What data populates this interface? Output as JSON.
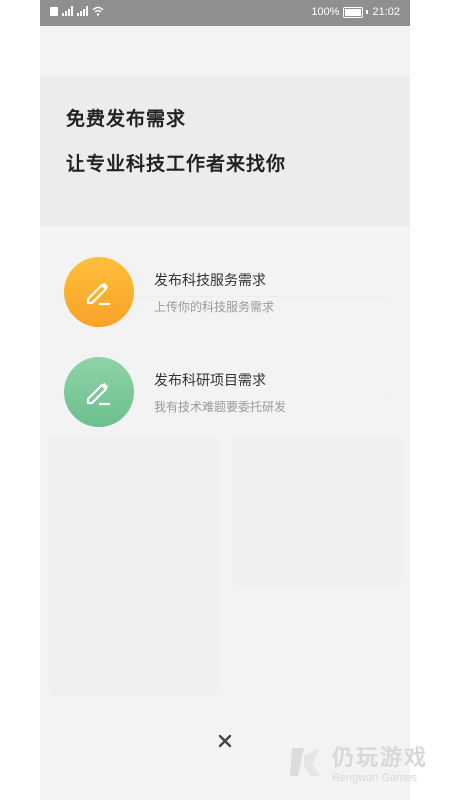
{
  "status_bar": {
    "battery_percent": "100%",
    "time": "21:02"
  },
  "headline": {
    "line1": "免费发布需求",
    "line2": "让专业科技工作者来找你"
  },
  "options": [
    {
      "title": "发布科技服务需求",
      "subtitle": "上传你的科技服务需求",
      "icon": "pencil-icon",
      "color": "#f7a226"
    },
    {
      "title": "发布科研项目需求",
      "subtitle": "我有技术难题要委托研发",
      "icon": "pencil-icon",
      "color": "#6cbf8e"
    }
  ],
  "close_icon": "close-icon",
  "watermark": {
    "cn": "仍玩游戏",
    "en": "Rengwan Games"
  }
}
